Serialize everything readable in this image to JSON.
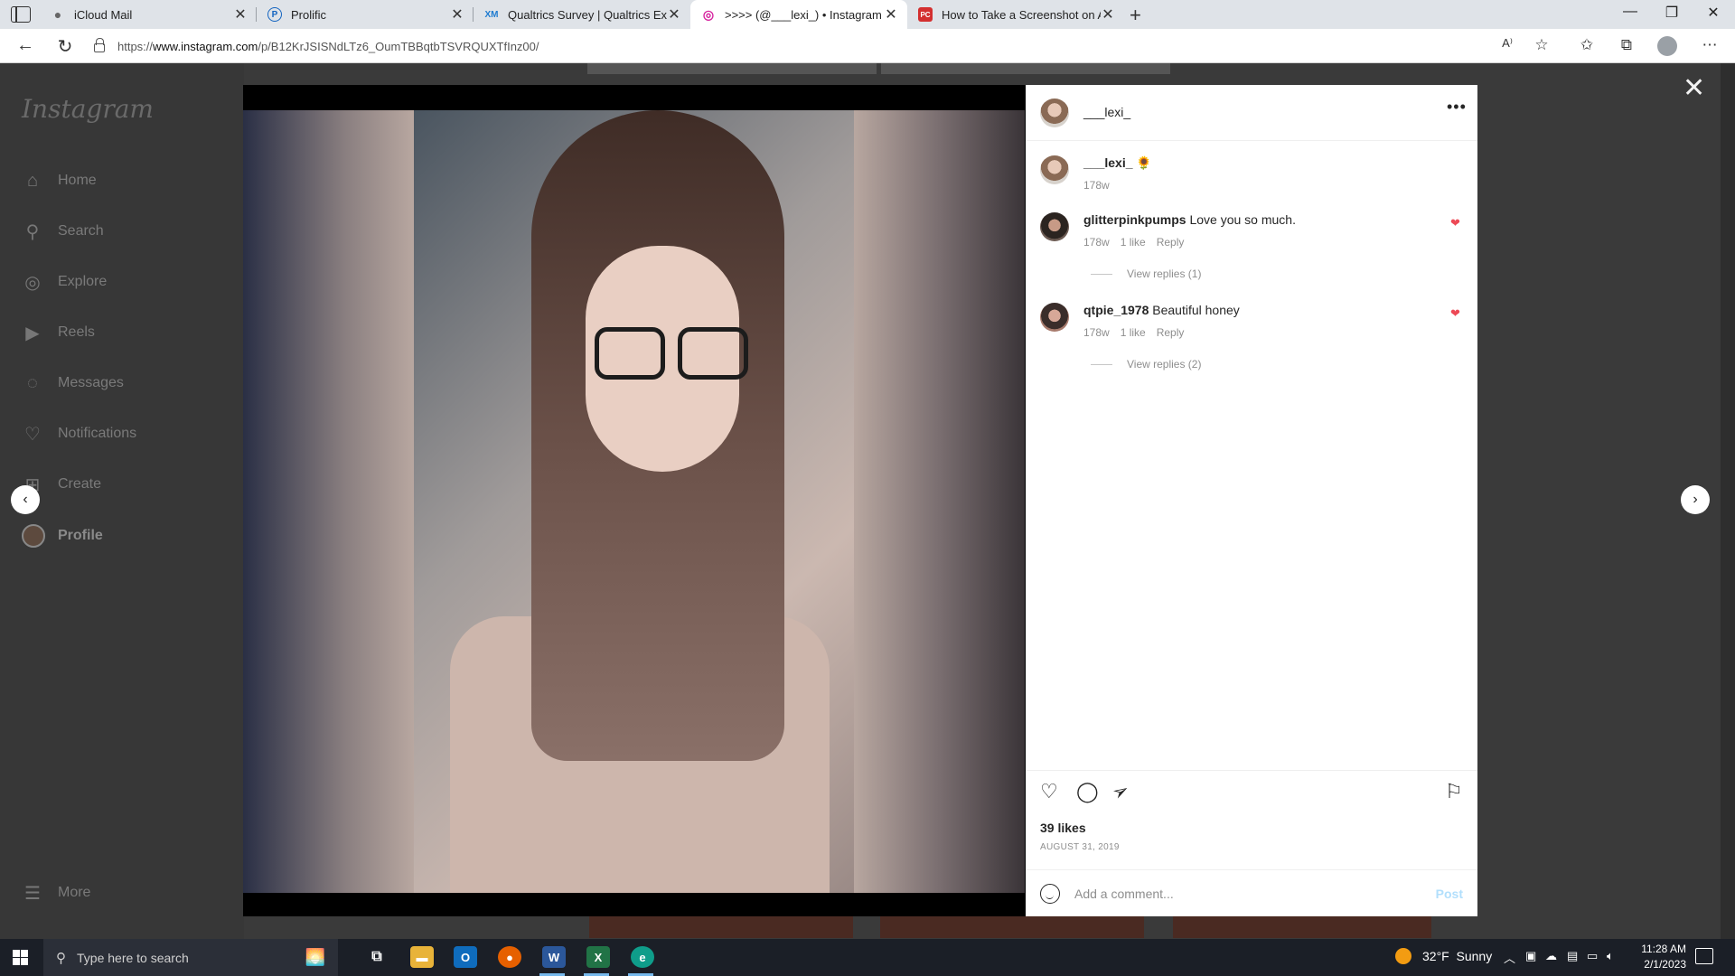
{
  "browser": {
    "tabs": [
      {
        "title": "iCloud Mail",
        "favicon": "apple-icon",
        "fav_text": "",
        "fav_color": "#666666"
      },
      {
        "title": "Prolific",
        "favicon": "prolific-icon",
        "fav_text": "P",
        "fav_color": "#1565c0"
      },
      {
        "title": "Qualtrics Survey | Qualtrics Exper",
        "favicon": "qualtrics-icon",
        "fav_text": "XM",
        "fav_color": "#1e7bd0"
      },
      {
        "title": ">>>> (@___lexi_) • Instagram p",
        "favicon": "instagram-icon",
        "fav_text": "◎",
        "fav_color": "#d6249f"
      },
      {
        "title": "How to Take a Screenshot on An",
        "favicon": "pcmag-icon",
        "fav_text": "PC",
        "fav_color": "#d32f2f"
      }
    ],
    "close_glyph": "✕",
    "new_tab_glyph": "+",
    "url_prefix": "https://",
    "url_domain": "www.instagram.com",
    "url_path": "/p/B12KrJSISNdLTz6_OumTBBqtbTSVRQUXTfInz00/"
  },
  "sidebar": {
    "logo": "Instagram",
    "items": [
      {
        "label": "Home",
        "icon": "home-icon",
        "glyph": "⌂"
      },
      {
        "label": "Search",
        "icon": "search-icon",
        "glyph": "⚲"
      },
      {
        "label": "Explore",
        "icon": "compass-icon",
        "glyph": "◎"
      },
      {
        "label": "Reels",
        "icon": "reels-icon",
        "glyph": "▶"
      },
      {
        "label": "Messages",
        "icon": "messenger-icon",
        "glyph": "◌"
      },
      {
        "label": "Notifications",
        "icon": "heart-icon",
        "glyph": "♡"
      },
      {
        "label": "Create",
        "icon": "plus-square-icon",
        "glyph": "⊞"
      },
      {
        "label": "Profile",
        "icon": "avatar",
        "glyph": ""
      }
    ],
    "more": {
      "label": "More",
      "icon": "hamburger-icon",
      "glyph": "☰"
    }
  },
  "modal": {
    "close_glyph": "✕",
    "prev_glyph": "‹",
    "next_glyph": "›"
  },
  "post": {
    "author": "___lexi_",
    "more_glyph": "•••",
    "caption": {
      "user": "___lexi_",
      "emoji": "🌻",
      "age": "178w"
    },
    "comments": [
      {
        "user": "glitterpinkpumps",
        "text": "Love you so much.",
        "age": "178w",
        "likes": "1 like",
        "reply": "Reply",
        "view_replies": "View replies (1)",
        "liked": true
      },
      {
        "user": "qtpie_1978",
        "text": "Beautiful honey",
        "age": "178w",
        "likes": "1 like",
        "reply": "Reply",
        "view_replies": "View replies (2)",
        "liked": true
      }
    ],
    "likes": "39 likes",
    "date": "AUGUST 31, 2019",
    "add_comment_placeholder": "Add a comment...",
    "post_button": "Post",
    "heart_glyph": "♡",
    "comment_glyph": "◯",
    "share_glyph": "➢",
    "save_glyph": "⚐",
    "liked_heart_glyph": "❤"
  },
  "taskbar": {
    "search_placeholder": "Type here to search",
    "weather_temp": "32°F",
    "weather_desc": "Sunny",
    "time": "11:28 AM",
    "date": "2/1/2023"
  },
  "colors": {
    "instagram_like": "#ed4956",
    "post_disabled": "#b2dffc"
  }
}
